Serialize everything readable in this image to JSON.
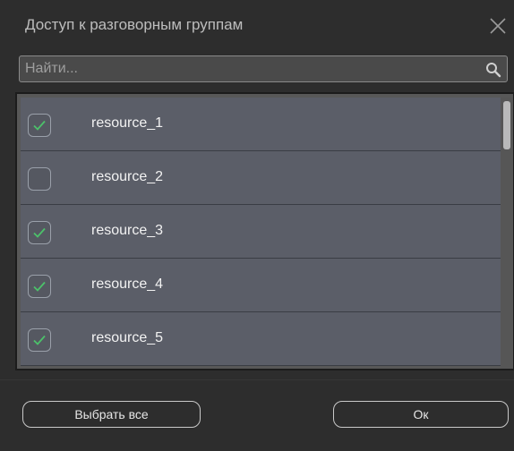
{
  "dialog": {
    "title": "Доступ к разговорным группам",
    "close_icon": "close-icon"
  },
  "search": {
    "placeholder": "Найти...",
    "value": "",
    "icon": "search-icon"
  },
  "list": {
    "items": [
      {
        "label": "resource_1",
        "checked": true
      },
      {
        "label": "resource_2",
        "checked": false
      },
      {
        "label": "resource_3",
        "checked": true
      },
      {
        "label": "resource_4",
        "checked": true
      },
      {
        "label": "resource_5",
        "checked": true
      }
    ]
  },
  "buttons": {
    "select_all": "Выбрать все",
    "ok": "Ок"
  },
  "colors": {
    "background": "#2d2d2d",
    "row": "#5b5e68",
    "check": "#4cc26a"
  }
}
